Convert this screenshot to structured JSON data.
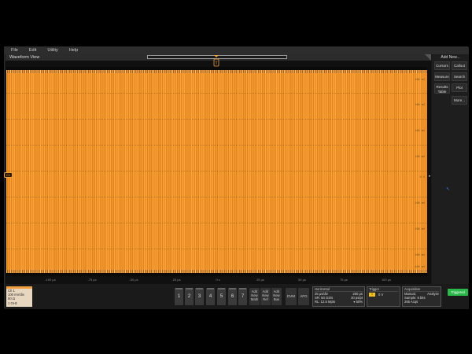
{
  "menu": [
    "File",
    "Edit",
    "Utility",
    "Help"
  ],
  "waveform_view": {
    "title": "Waveform View",
    "channel_marker": "C1",
    "right_marker": "▸",
    "y_labels": [
      "400 mV",
      "300 mV",
      "200 mV",
      "100 mV",
      "0 V",
      "-100 mV",
      "-200 mV",
      "-300 mV",
      "-400 mV"
    ],
    "x_labels": [
      "-100 μs",
      "-75 μs",
      "-50 μs",
      "-25 μs",
      "0 s",
      "25 μs",
      "50 μs",
      "75 μs",
      "100 μs"
    ],
    "trace_color": "#f0901f"
  },
  "side_panel": {
    "add_new": "Add New...",
    "buttons": [
      {
        "label": "Cursors"
      },
      {
        "label": "Callout"
      },
      {
        "label": "Measure"
      },
      {
        "label": "Search"
      },
      {
        "label": "Results Table"
      },
      {
        "label": "Plot"
      },
      {
        "label": "More..."
      }
    ]
  },
  "channel_badge": {
    "title": "Ch 1",
    "line1": "100 mV/div",
    "line2": "50 Ω",
    "line3": "1 GHz"
  },
  "channel_buttons": [
    "1",
    "2",
    "3",
    "4",
    "5",
    "6",
    "7",
    "8"
  ],
  "add_buttons": [
    "Add New Math",
    "Add New Ref",
    "Add New Bus"
  ],
  "tool_buttons": [
    "DVM",
    "AFG"
  ],
  "horizontal": {
    "header": "Horizontal",
    "r1l": "25 μs/div",
    "r1r": "250 μs",
    "r2l": "SR: 50 GS/s",
    "r2r": "20 ps/pt",
    "r3l": "RL: 12.5 Mpts",
    "r3r": "▾ 50%"
  },
  "trigger": {
    "header": "Trigger",
    "chip": "1",
    "level": "0 V"
  },
  "acquisition": {
    "header": "Acquisition",
    "r1l": "Manual,",
    "r1r": "Analyze",
    "r2": "Sample: 8 bits",
    "r3": "265 Acqs"
  },
  "status": "Triggered",
  "colors": {
    "accent": "#f0a040",
    "trigger_chip": "#f0c020",
    "triggered": "#2bb84a"
  }
}
